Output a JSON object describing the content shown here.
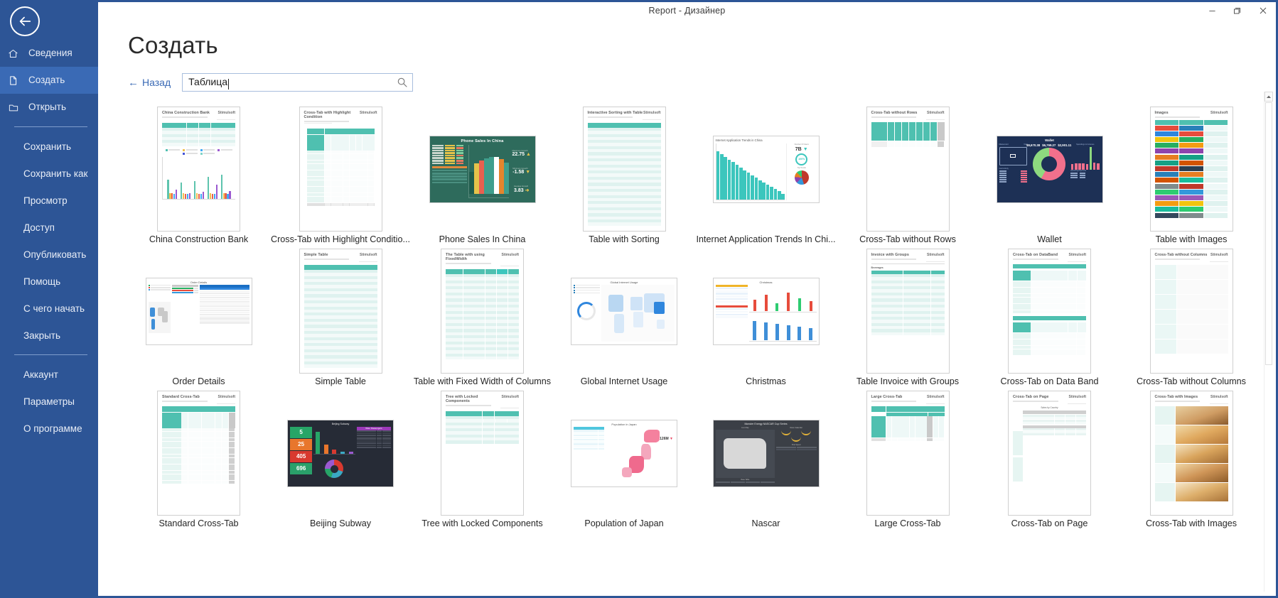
{
  "window": {
    "title": "Report - Дизайнер",
    "controls": [
      {
        "name": "minimize-button",
        "glyph": "—"
      },
      {
        "name": "maximize-button",
        "glyph": "❐"
      },
      {
        "name": "close-button",
        "glyph": "✕"
      }
    ]
  },
  "sidebar": {
    "back_button_label": "back-arrow",
    "items": [
      {
        "label": "Сведения",
        "icon": "home-icon",
        "active": false,
        "type": "icon"
      },
      {
        "label": "Создать",
        "icon": "document-icon",
        "active": true,
        "type": "icon"
      },
      {
        "label": "Открыть",
        "icon": "folder-icon",
        "active": false,
        "type": "icon"
      },
      {
        "label": "Сохранить",
        "icon": "",
        "active": false,
        "type": "plain"
      },
      {
        "label": "Сохранить как",
        "icon": "",
        "active": false,
        "type": "plain"
      },
      {
        "label": "Просмотр",
        "icon": "",
        "active": false,
        "type": "plain"
      },
      {
        "label": "Доступ",
        "icon": "",
        "active": false,
        "type": "plain"
      },
      {
        "label": "Опубликовать",
        "icon": "",
        "active": false,
        "type": "plain"
      },
      {
        "label": "Помощь",
        "icon": "",
        "active": false,
        "type": "plain"
      },
      {
        "label": "С чего начать",
        "icon": "",
        "active": false,
        "type": "plain"
      },
      {
        "label": "Закрыть",
        "icon": "",
        "active": false,
        "type": "plain"
      },
      {
        "label": "Аккаунт",
        "icon": "",
        "active": false,
        "type": "plain"
      },
      {
        "label": "Параметры",
        "icon": "",
        "active": false,
        "type": "plain"
      },
      {
        "label": "О программе",
        "icon": "",
        "active": false,
        "type": "plain"
      }
    ],
    "separator_after_index": 10,
    "accent_color": "#2d5596",
    "active_color": "#3a6ab5"
  },
  "page": {
    "heading": "Создать",
    "back_link": "Назад",
    "back_arrow": "←",
    "search": {
      "value": "Таблица",
      "placeholder": "",
      "icon": "search-icon"
    }
  },
  "gallery": {
    "templates": [
      {
        "caption": "China Construction Bank",
        "orientation": "portrait",
        "kind": "table-chart"
      },
      {
        "caption": "Cross-Tab with Highlight Conditio...",
        "orientation": "portrait",
        "kind": "crosstab"
      },
      {
        "caption": "Phone Sales In China",
        "orientation": "landscape",
        "kind": "dash-green"
      },
      {
        "caption": "Table with Sorting",
        "orientation": "portrait",
        "kind": "table"
      },
      {
        "caption": "Internet Application Trends In Chi...",
        "orientation": "landscape",
        "kind": "dash-teal"
      },
      {
        "caption": "Cross-Tab without Rows",
        "orientation": "portrait",
        "kind": "crosstab-norows"
      },
      {
        "caption": "Wallet",
        "orientation": "landscape",
        "kind": "dash-wallet"
      },
      {
        "caption": "Table with Images",
        "orientation": "portrait",
        "kind": "images"
      },
      {
        "caption": "Order Details",
        "orientation": "landscape",
        "kind": "dash-order"
      },
      {
        "caption": "Simple Table",
        "orientation": "portrait",
        "kind": "table"
      },
      {
        "caption": "Table with Fixed Width of Columns",
        "orientation": "portrait",
        "kind": "table"
      },
      {
        "caption": "Global Internet Usage",
        "orientation": "landscape",
        "kind": "dash-globe"
      },
      {
        "caption": "Christmas",
        "orientation": "landscape",
        "kind": "dash-christmas"
      },
      {
        "caption": "Table Invoice with Groups",
        "orientation": "portrait",
        "kind": "invoice"
      },
      {
        "caption": "Cross-Tab on Data Band",
        "orientation": "portrait",
        "kind": "crosstab-band"
      },
      {
        "caption": "Cross-Tab without Columns",
        "orientation": "portrait",
        "kind": "crosstab-nocols"
      },
      {
        "caption": "Standard Cross-Tab",
        "orientation": "portrait",
        "kind": "crosstab"
      },
      {
        "caption": "Beijing Subway",
        "orientation": "landscape",
        "kind": "dash-subway"
      },
      {
        "caption": "Tree with Locked Components",
        "orientation": "portrait",
        "kind": "tree"
      },
      {
        "caption": "Population of Japan",
        "orientation": "landscape",
        "kind": "dash-japan"
      },
      {
        "caption": "Nascar",
        "orientation": "landscape",
        "kind": "dash-nascar"
      },
      {
        "caption": "Large Cross-Tab",
        "orientation": "portrait",
        "kind": "crosstab-large"
      },
      {
        "caption": "Cross-Tab on Page",
        "orientation": "portrait",
        "kind": "crosstab-page"
      },
      {
        "caption": "Cross-Tab with Images",
        "orientation": "portrait",
        "kind": "crosstab-images"
      }
    ],
    "brand_label": "Stimulsoft"
  },
  "scrollbar": {
    "up_arrow": "▲",
    "position": "near-top"
  }
}
